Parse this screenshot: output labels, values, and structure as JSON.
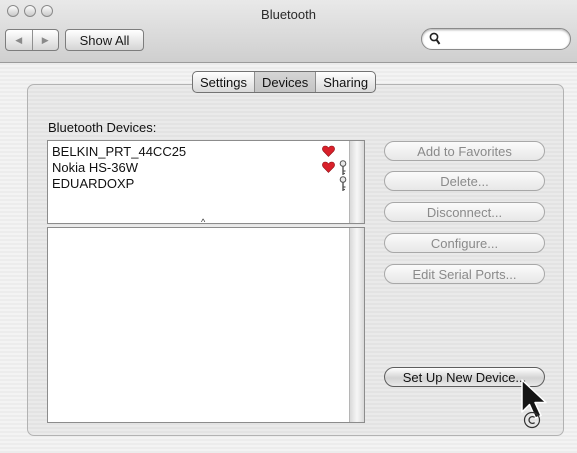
{
  "window": {
    "title": "Bluetooth",
    "back_glyph": "◀",
    "forward_glyph": "▶",
    "show_all_label": "Show All",
    "search": {
      "value": "",
      "placeholder": "",
      "icon": "search-icon"
    }
  },
  "tabs": [
    {
      "label": "Settings",
      "active": false
    },
    {
      "label": "Devices",
      "active": true
    },
    {
      "label": "Sharing",
      "active": false
    }
  ],
  "devices": {
    "section_label": "Bluetooth Devices:",
    "items": [
      {
        "name": "BELKIN_PRT_44CC25",
        "favorite": true,
        "paired": false
      },
      {
        "name": "Nokia HS-36W",
        "favorite": true,
        "paired": true
      },
      {
        "name": "EDUARDOXP",
        "favorite": false,
        "paired": true
      }
    ],
    "splitter_glyph": "^"
  },
  "actions": {
    "add_to_favorites": "Add to Favorites",
    "delete": "Delete...",
    "disconnect": "Disconnect...",
    "configure": "Configure...",
    "edit_serial_ports": "Edit Serial Ports...",
    "set_up_new_device": "Set Up New Device..."
  },
  "colors": {
    "favorite_heart": "#d9202a",
    "disabled_text": "#8a8a8a"
  }
}
